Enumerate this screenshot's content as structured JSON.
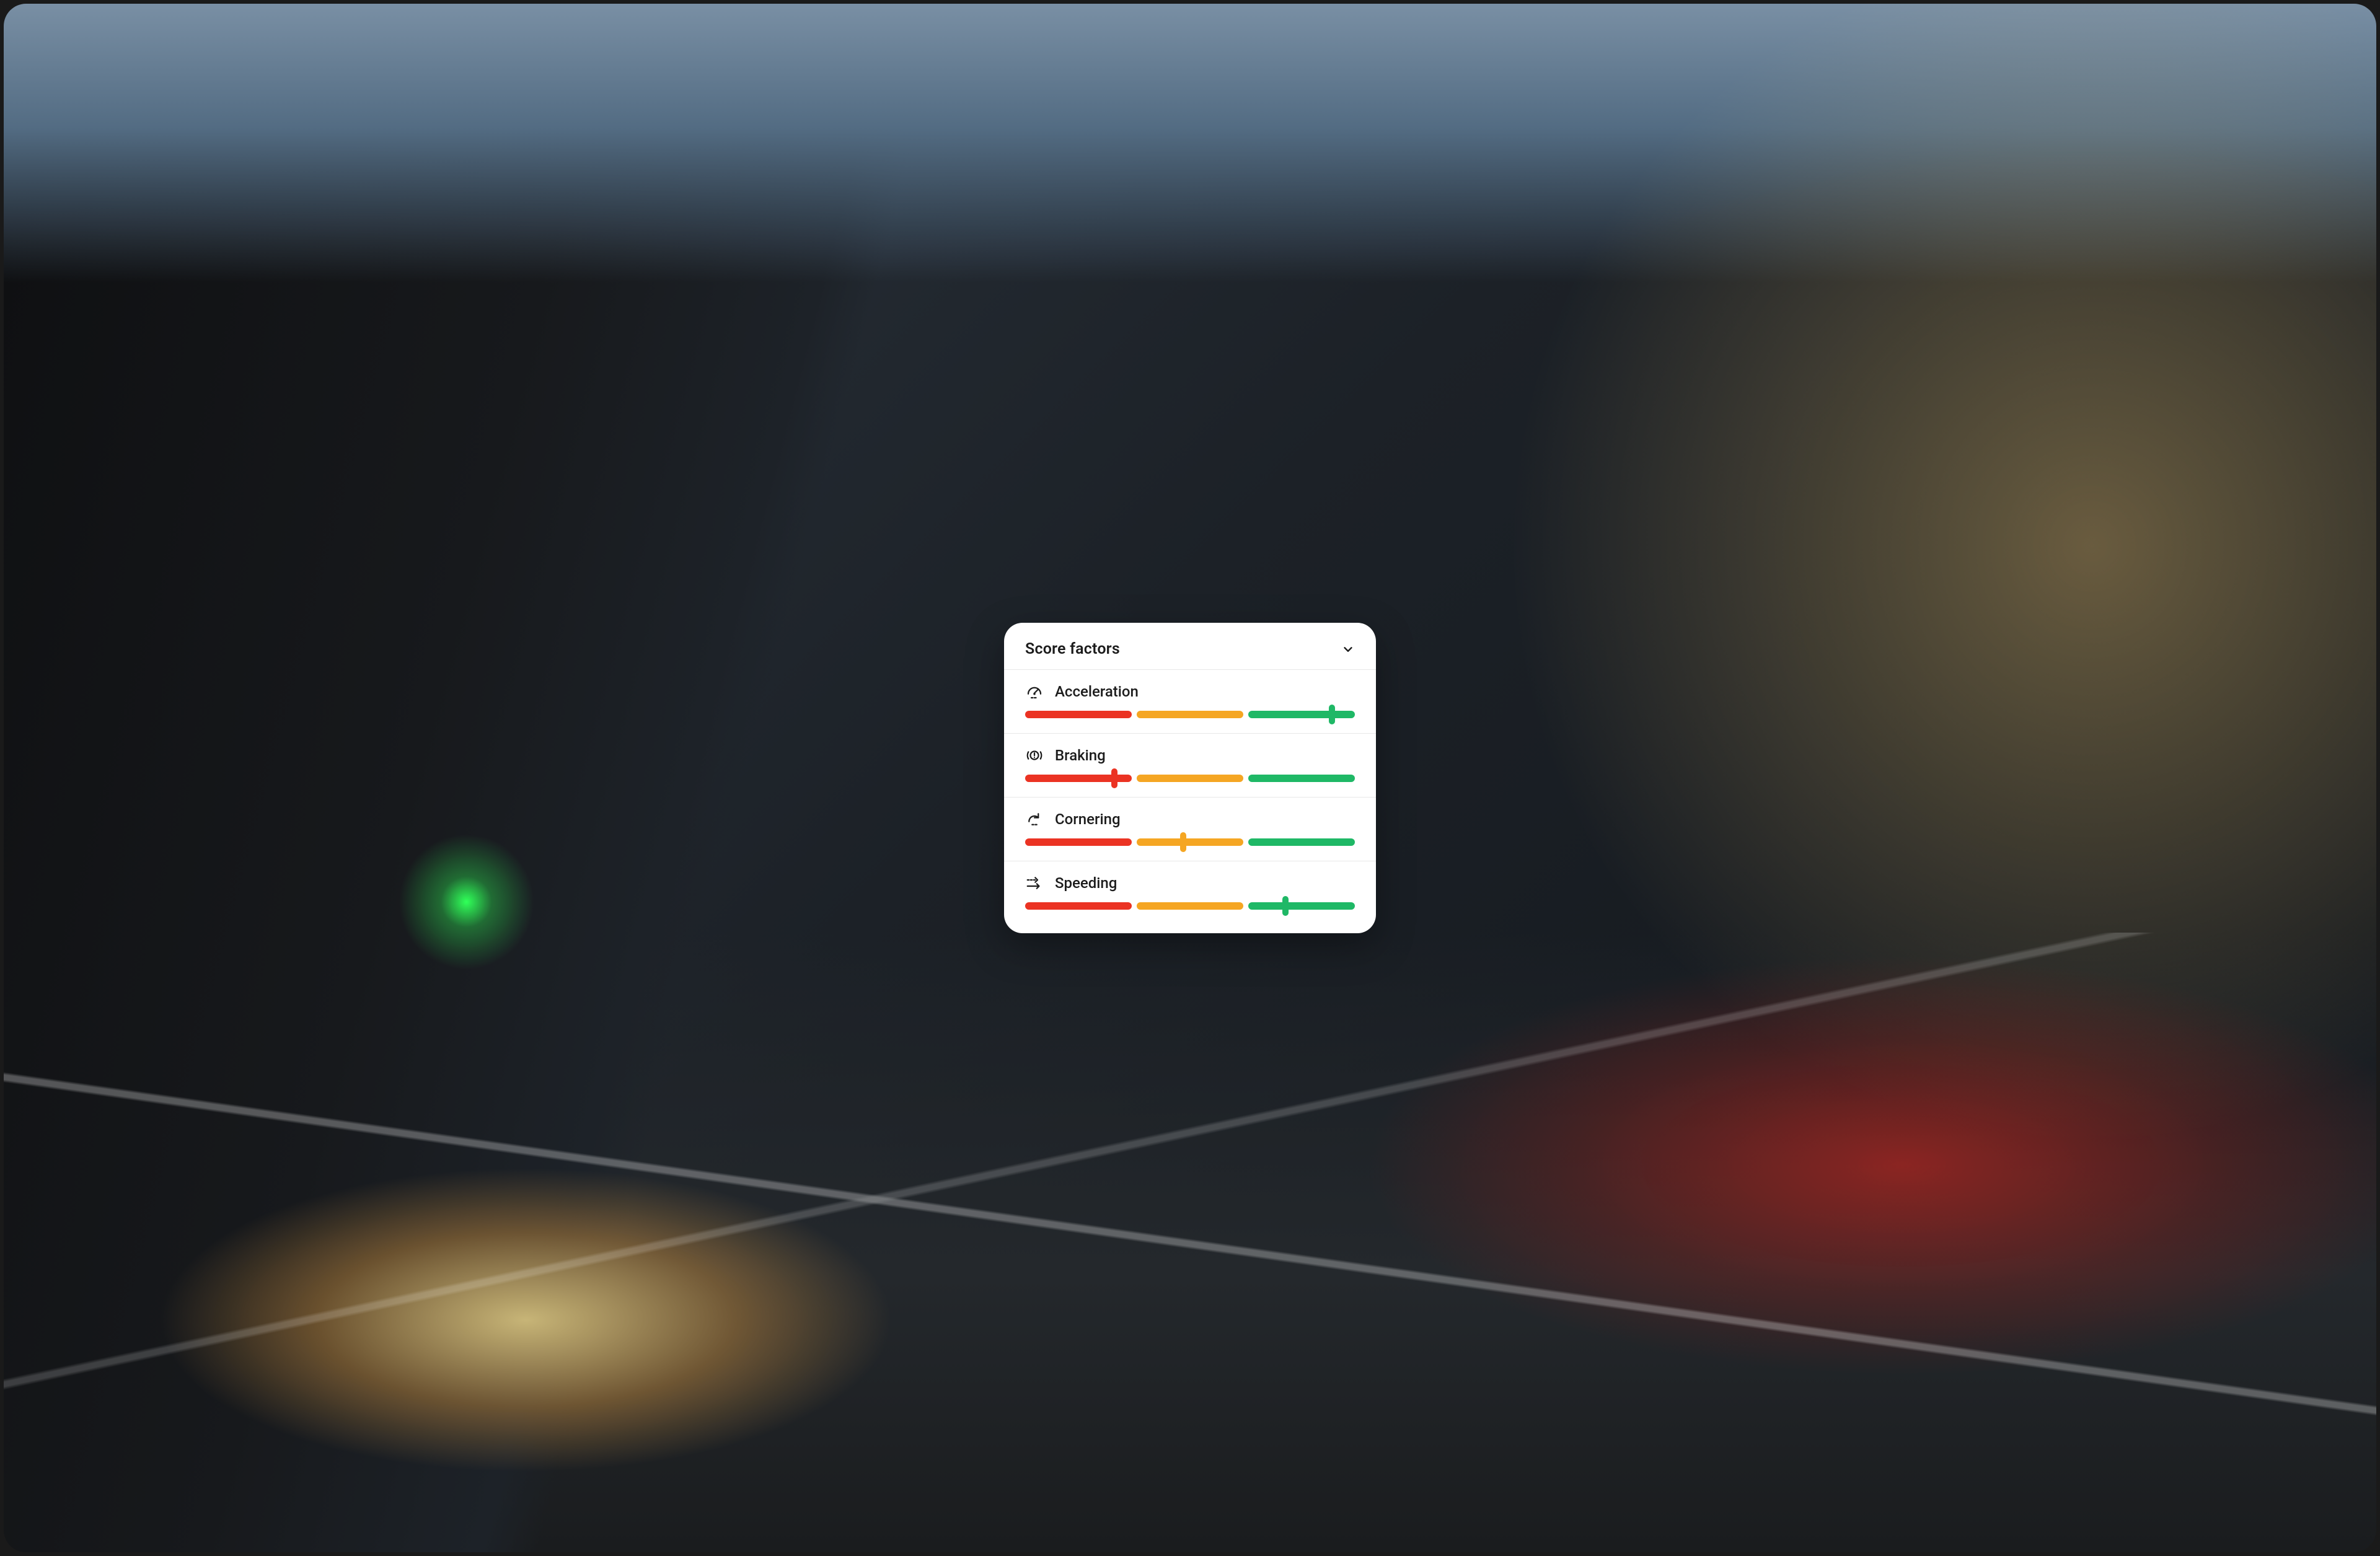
{
  "card": {
    "title": "Score factors",
    "colors": {
      "red": "#EB3323",
      "orange": "#F5A623",
      "green": "#1FB866"
    },
    "factors": [
      {
        "id": "acceleration",
        "icon": "speedometer-icon",
        "label": "Acceleration",
        "value": 93
      },
      {
        "id": "braking",
        "icon": "brake-icon",
        "label": "Braking",
        "value": 27
      },
      {
        "id": "cornering",
        "icon": "cornering-icon",
        "label": "Cornering",
        "value": 48
      },
      {
        "id": "speeding",
        "icon": "speeding-icon",
        "label": "Speeding",
        "value": 79
      }
    ]
  }
}
